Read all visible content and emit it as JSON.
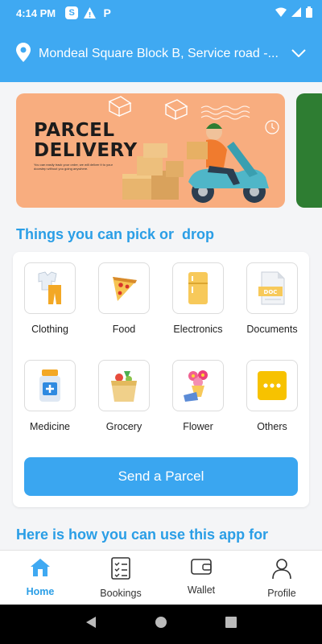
{
  "status_bar": {
    "time": "4:14 PM",
    "s_badge": "S",
    "alert_glyph": "!",
    "p_glyph": "P"
  },
  "location": {
    "address": "Mondeal Square Block B, Service road -..."
  },
  "banner": {
    "title_line1": "PARCEL",
    "title_line2": "DELIVERY",
    "subtitle": "You can easily track your order, we will deliver it to your doorstep without you going anywhere."
  },
  "section_title": "Things you can pick or  drop",
  "categories": [
    {
      "label": "Clothing",
      "icon": "clothing-icon"
    },
    {
      "label": "Food",
      "icon": "pizza-icon"
    },
    {
      "label": "Electronics",
      "icon": "fridge-icon"
    },
    {
      "label": "Documents",
      "icon": "document-icon"
    },
    {
      "label": "Medicine",
      "icon": "medicine-bottle-icon"
    },
    {
      "label": "Grocery",
      "icon": "grocery-bag-icon"
    },
    {
      "label": "Flower",
      "icon": "flower-bouquet-icon"
    },
    {
      "label": "Others",
      "icon": "more-dots-icon"
    }
  ],
  "doc_icon_text": "DOC",
  "send_button": "Send a Parcel",
  "section_title_2": "Here is how you can use this app for",
  "bottom_nav": [
    {
      "label": "Home",
      "icon": "home-icon",
      "active": true
    },
    {
      "label": "Bookings",
      "icon": "checklist-icon",
      "active": false
    },
    {
      "label": "Wallet",
      "icon": "wallet-icon",
      "active": false
    },
    {
      "label": "Profile",
      "icon": "person-icon",
      "active": false
    }
  ],
  "colors": {
    "primary": "#3fa9f2",
    "title_blue": "#2a9ee6",
    "banner": "#f8ad7f",
    "banner_next": "#2e7d32",
    "others_icon": "#f7c200"
  }
}
